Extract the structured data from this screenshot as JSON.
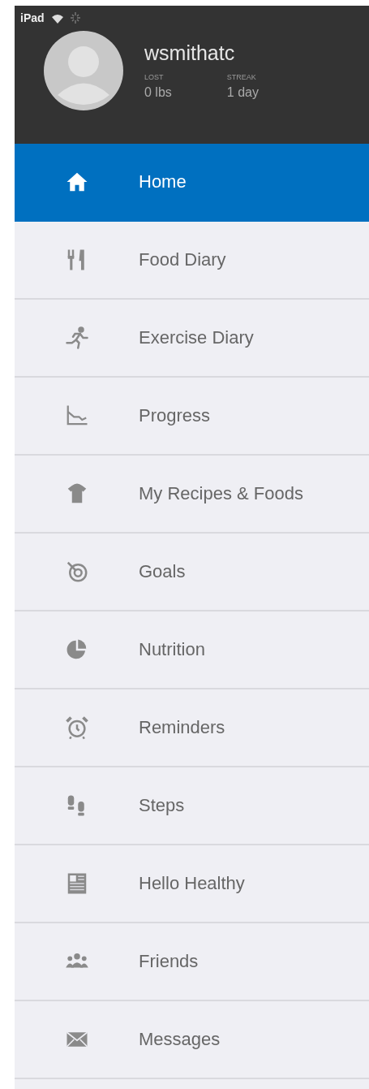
{
  "status_bar": {
    "device": "iPad"
  },
  "profile": {
    "username": "wsmithatc",
    "stats": [
      {
        "label": "LOST",
        "value": "0 lbs"
      },
      {
        "label": "STREAK",
        "value": "1 day"
      }
    ]
  },
  "menu": [
    {
      "label": "Home",
      "selected": true
    },
    {
      "label": "Food Diary",
      "selected": false
    },
    {
      "label": "Exercise Diary",
      "selected": false
    },
    {
      "label": "Progress",
      "selected": false
    },
    {
      "label": "My Recipes & Foods",
      "selected": false
    },
    {
      "label": "Goals",
      "selected": false
    },
    {
      "label": "Nutrition",
      "selected": false
    },
    {
      "label": "Reminders",
      "selected": false
    },
    {
      "label": "Steps",
      "selected": false
    },
    {
      "label": "Hello Healthy",
      "selected": false
    },
    {
      "label": "Friends",
      "selected": false
    },
    {
      "label": "Messages",
      "selected": false
    }
  ]
}
